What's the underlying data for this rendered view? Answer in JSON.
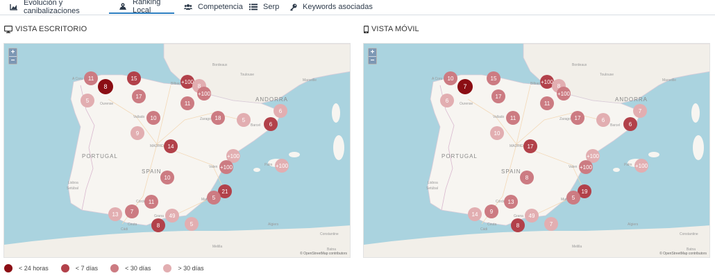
{
  "tabs": [
    {
      "label": "Evolución y canibalizaciones",
      "icon": "area-chart-icon",
      "active": false
    },
    {
      "label": "Ranking Local",
      "icon": "map-location-icon",
      "active": true
    },
    {
      "label": "Competencia",
      "icon": "users-icon",
      "active": false
    },
    {
      "label": "Serp",
      "icon": "list-icon",
      "active": false
    },
    {
      "label": "Keywords asociadas",
      "icon": "key-icon",
      "active": false
    }
  ],
  "desktop": {
    "title": "VISTA ESCRITORIO",
    "icon": "desktop-icon",
    "markers": [
      {
        "value": "11",
        "level": "lt30"
      },
      {
        "value": "8",
        "level": "lt24"
      },
      {
        "value": "15",
        "level": "lt7"
      },
      {
        "value": "+100",
        "level": "lt7"
      },
      {
        "value": "8",
        "level": "gt30"
      },
      {
        "value": "+100",
        "level": "lt30"
      },
      {
        "value": "5",
        "level": "gt30"
      },
      {
        "value": "17",
        "level": "lt30"
      },
      {
        "value": "11",
        "level": "lt30"
      },
      {
        "value": "10",
        "level": "lt30"
      },
      {
        "value": "18",
        "level": "lt30"
      },
      {
        "value": "5",
        "level": "gt30"
      },
      {
        "value": "6",
        "level": "gt30"
      },
      {
        "value": "6",
        "level": "lt7"
      },
      {
        "value": "9",
        "level": "gt30"
      },
      {
        "value": "14",
        "level": "lt7"
      },
      {
        "value": "+100",
        "level": "gt30"
      },
      {
        "value": "+100",
        "level": "lt30"
      },
      {
        "value": "+100",
        "level": "gt30"
      },
      {
        "value": "10",
        "level": "lt30"
      },
      {
        "value": "21",
        "level": "lt7"
      },
      {
        "value": "5",
        "level": "lt30"
      },
      {
        "value": "11",
        "level": "lt30"
      },
      {
        "value": "7",
        "level": "lt30"
      },
      {
        "value": "13",
        "level": "gt30"
      },
      {
        "value": "49",
        "level": "gt30"
      },
      {
        "value": "5",
        "level": "gt30"
      },
      {
        "value": "8",
        "level": "lt7"
      }
    ]
  },
  "mobile": {
    "title": "VISTA MÓVIL",
    "icon": "mobile-phone-icon",
    "markers": [
      {
        "value": "10",
        "level": "lt30"
      },
      {
        "value": "7",
        "level": "lt24"
      },
      {
        "value": "15",
        "level": "lt30"
      },
      {
        "value": "+100",
        "level": "lt7"
      },
      {
        "value": "8",
        "level": "gt30"
      },
      {
        "value": "+100",
        "level": "lt30"
      },
      {
        "value": "6",
        "level": "gt30"
      },
      {
        "value": "17",
        "level": "lt30"
      },
      {
        "value": "11",
        "level": "lt30"
      },
      {
        "value": "11",
        "level": "lt30"
      },
      {
        "value": "17",
        "level": "lt30"
      },
      {
        "value": "6",
        "level": "gt30"
      },
      {
        "value": "7",
        "level": "gt30"
      },
      {
        "value": "6",
        "level": "lt7"
      },
      {
        "value": "10",
        "level": "gt30"
      },
      {
        "value": "17",
        "level": "lt7"
      },
      {
        "value": "+100",
        "level": "gt30"
      },
      {
        "value": "+100",
        "level": "lt30"
      },
      {
        "value": "+100",
        "level": "gt30"
      },
      {
        "value": "8",
        "level": "lt30"
      },
      {
        "value": "19",
        "level": "lt7"
      },
      {
        "value": "5",
        "level": "lt30"
      },
      {
        "value": "13",
        "level": "lt30"
      },
      {
        "value": "9",
        "level": "lt30"
      },
      {
        "value": "14",
        "level": "gt30"
      },
      {
        "value": "49",
        "level": "gt30"
      },
      {
        "value": "7",
        "level": "gt30"
      },
      {
        "value": "8",
        "level": "lt7"
      }
    ]
  },
  "map_labels": {
    "portugal": "PORTUGAL",
    "spain": "SPAIN",
    "andorra": "ANDORRA",
    "madrid": "MADRID",
    "bordeaux": "Bordeaux",
    "toulouse": "Toulouse",
    "marseille": "Marseille",
    "bilbao": "Bilbao",
    "valladolid": "Vallado",
    "zaragoza": "Zarago",
    "barcelona": "Barcel",
    "valencia": "Valen",
    "palma": "Palm",
    "cordoba": "Córdo",
    "granada": "Grana",
    "murcia": "Murc",
    "ourense": "Ourense",
    "acoruna": "A Coru",
    "lisboa": "Lisboa",
    "setubal": "Setúbal",
    "algiers": "Algiers",
    "constantine": "Constantine",
    "batna": "Batna",
    "ceuta": "Ceuta",
    "cadiz": "Cádi",
    "melilla": "Melilla",
    "attribution": "© OpenStreetMap contributors"
  },
  "zoom": {
    "in": "+",
    "out": "−"
  },
  "legend": [
    {
      "label": "< 24 horas",
      "color": "#8b0e14"
    },
    {
      "label": "< 7 días",
      "color": "#b2414a"
    },
    {
      "label": "< 30 días",
      "color": "#cc7b82"
    },
    {
      "label": "> 30 días",
      "color": "#e2aeb1"
    }
  ],
  "level_colors": {
    "lt24": "#8b0e14",
    "lt7": "#b2414a",
    "lt30": "#cc7b82",
    "gt30": "#e2aeb1"
  }
}
